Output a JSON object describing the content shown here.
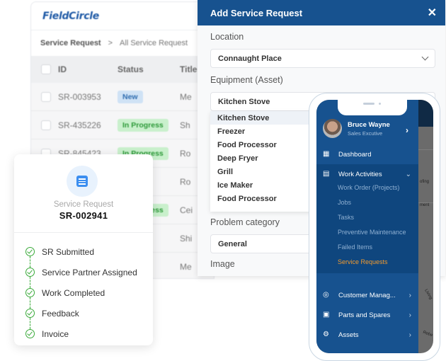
{
  "app": {
    "logo": "FieldCircle",
    "breadcrumb": [
      "Service Request",
      ">",
      "All Service Request"
    ],
    "table": {
      "columns": [
        "ID",
        "Status",
        "Title"
      ],
      "rows": [
        {
          "id": "SR-003953",
          "status": "New",
          "title": "Me"
        },
        {
          "id": "SR-435226",
          "status": "In Progress",
          "title": "Sh"
        },
        {
          "id": "SR-845423",
          "status": "In Progress",
          "title": "Ro"
        },
        {
          "id": "",
          "status": "",
          "title": "Ro"
        },
        {
          "id": "",
          "status": "In Progress",
          "title": "Cei"
        },
        {
          "id": "",
          "status": "",
          "title": "Shi"
        },
        {
          "id": "",
          "status": "",
          "title": "Me"
        }
      ]
    }
  },
  "modal": {
    "title": "Add Service Request",
    "close_icon": "close-icon",
    "location_label": "Location",
    "location_value": "Connaught Place",
    "equipment_label": "Equipment (Asset)",
    "equipment_value": "Kitchen Stove",
    "equipment_options": [
      "Kitchen Stove",
      "Freezer",
      "Food Processor",
      "Deep Fryer",
      "Grill",
      "Ice Maker",
      "Food Processor"
    ],
    "problem_label": "Problem category",
    "problem_value": "General",
    "image_label": "Image"
  },
  "card": {
    "icon": "list-icon",
    "subtitle": "Service Request",
    "sr_id": "SR-002941",
    "steps": [
      "SR Submitted",
      "Service Partner Assigned",
      "Work Completed",
      "Feedback",
      "Invoice"
    ],
    "accent": "#3aaa3a"
  },
  "phone": {
    "user_name": "Bruce Wayne",
    "user_role": "Sales Excutive",
    "menu": [
      {
        "label": "Dashboard",
        "icon": "dashboard-icon"
      },
      {
        "label": "Work Activities",
        "icon": "clipboard-icon"
      },
      {
        "label": "Customer Manag...",
        "icon": "target-icon"
      },
      {
        "label": "Parts and Spares",
        "icon": "box-icon"
      },
      {
        "label": "Assets",
        "icon": "assets-icon"
      }
    ],
    "submenu": [
      "Work Order (Projects)",
      "Jobs",
      "Tasks",
      "Preventive Maintenance",
      "Failed Items",
      "Service Requests"
    ],
    "map_labels": [
      "ofing",
      "ment",
      "Living",
      "Rebe"
    ],
    "brand_color": "#17528f",
    "highlight_color": "#f29a2e"
  }
}
